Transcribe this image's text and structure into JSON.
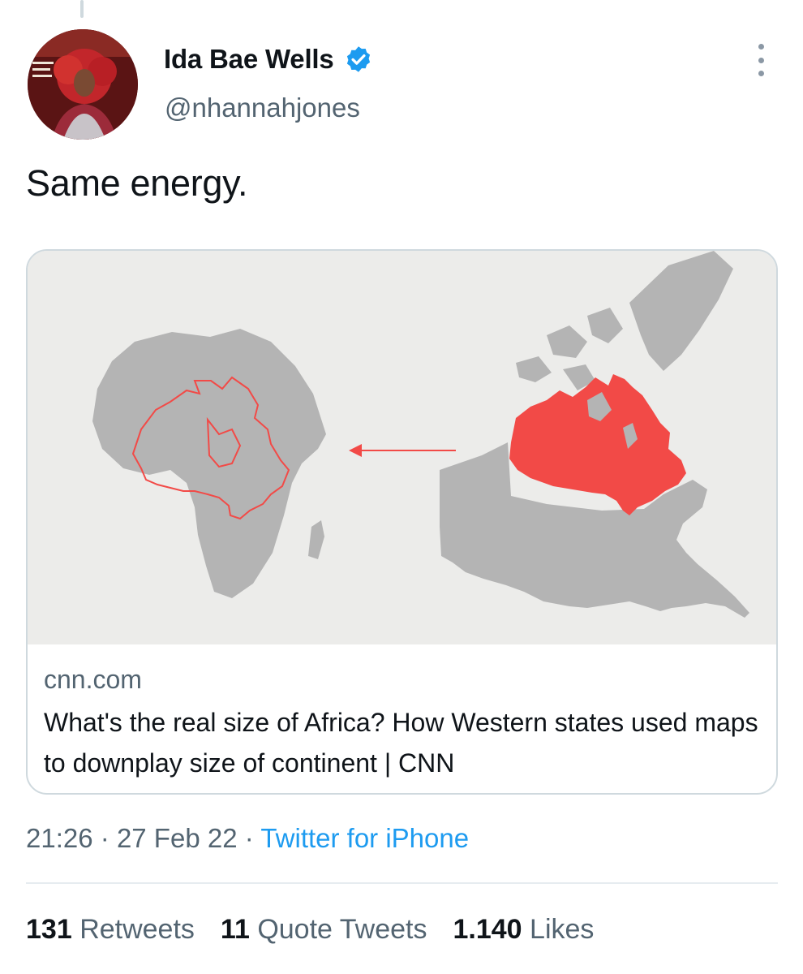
{
  "tweet": {
    "author": {
      "display_name": "Ida Bae Wells",
      "handle": "@nhannahjones",
      "verified": true
    },
    "text": "Same energy.",
    "card": {
      "domain": "cnn.com",
      "title": "What's the real size of Africa? How Western states used maps to downplay size of continent | CNN"
    },
    "meta": {
      "time": "21:26",
      "date": "27 Feb 22",
      "separator": "·",
      "source": "Twitter for iPhone"
    },
    "stats": {
      "retweets": {
        "count": "131",
        "label": "Retweets"
      },
      "quote_tweets": {
        "count": "11",
        "label": "Quote Tweets"
      },
      "likes": {
        "count": "1.140",
        "label": "Likes"
      }
    }
  },
  "colors": {
    "link": "#1d9bf0",
    "secondary_text": "#536471",
    "map_land": "#b4b4b4",
    "map_highlight": "#f24a47"
  }
}
